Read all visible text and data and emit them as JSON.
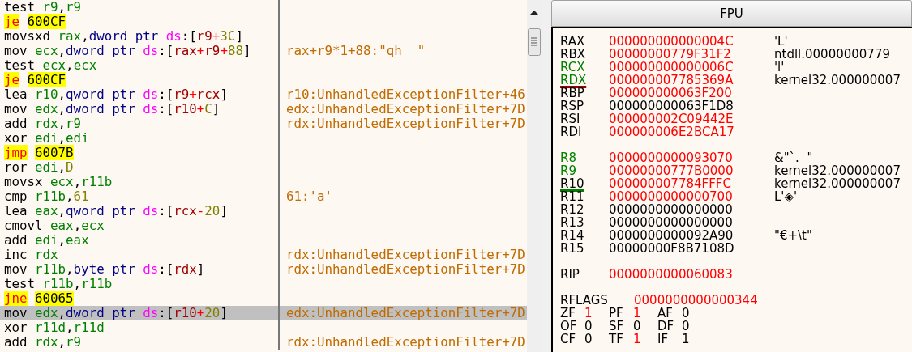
{
  "disassembly": [
    {
      "tokens": [
        {
          "text": "test ",
          "kind": "mnemonic"
        },
        {
          "text": "r9",
          "kind": "register"
        },
        {
          "text": ",",
          "kind": "punct"
        },
        {
          "text": "r9",
          "kind": "register"
        }
      ],
      "selected": false
    },
    {
      "tokens": [
        {
          "text": "je",
          "kind": "jump"
        },
        {
          "text": "600CF",
          "kind": "target"
        }
      ],
      "selected": false
    },
    {
      "tokens": [
        {
          "text": "movsxd ",
          "kind": "mnemonic"
        },
        {
          "text": "rax",
          "kind": "register"
        },
        {
          "text": ",",
          "kind": "punct"
        },
        {
          "text": "dword ptr ",
          "kind": "size"
        },
        {
          "text": "ds",
          "kind": "segment"
        },
        {
          "text": ":[",
          "kind": "punct"
        },
        {
          "text": "r9",
          "kind": "memreg"
        },
        {
          "text": "+",
          "kind": "operator"
        },
        {
          "text": "3C",
          "kind": "number"
        },
        {
          "text": "]",
          "kind": "punct"
        }
      ],
      "selected": false
    },
    {
      "tokens": [
        {
          "text": "mov ",
          "kind": "mnemonic"
        },
        {
          "text": "ecx",
          "kind": "register"
        },
        {
          "text": ",",
          "kind": "punct"
        },
        {
          "text": "dword ptr ",
          "kind": "size"
        },
        {
          "text": "ds",
          "kind": "segment"
        },
        {
          "text": ":[",
          "kind": "punct"
        },
        {
          "text": "rax",
          "kind": "memreg"
        },
        {
          "text": "+",
          "kind": "operator"
        },
        {
          "text": "r9",
          "kind": "memreg"
        },
        {
          "text": "+",
          "kind": "operator"
        },
        {
          "text": "88",
          "kind": "number"
        },
        {
          "text": "]",
          "kind": "punct"
        }
      ],
      "comment": "rax+r9*1+88:\"qh  \"",
      "selected": false
    },
    {
      "tokens": [
        {
          "text": "test ",
          "kind": "mnemonic"
        },
        {
          "text": "ecx",
          "kind": "register"
        },
        {
          "text": ",",
          "kind": "punct"
        },
        {
          "text": "ecx",
          "kind": "register"
        }
      ],
      "selected": false
    },
    {
      "tokens": [
        {
          "text": "je",
          "kind": "jump"
        },
        {
          "text": "600CF",
          "kind": "target"
        }
      ],
      "selected": false
    },
    {
      "tokens": [
        {
          "text": "lea ",
          "kind": "mnemonic"
        },
        {
          "text": "r10",
          "kind": "register"
        },
        {
          "text": ",",
          "kind": "punct"
        },
        {
          "text": "qword ptr ",
          "kind": "size"
        },
        {
          "text": "ds",
          "kind": "segment"
        },
        {
          "text": ":[",
          "kind": "punct"
        },
        {
          "text": "r9",
          "kind": "memreg"
        },
        {
          "text": "+",
          "kind": "operator"
        },
        {
          "text": "rcx",
          "kind": "memreg"
        },
        {
          "text": "]",
          "kind": "punct"
        }
      ],
      "comment": "r10:UnhandledExceptionFilter+46",
      "selected": false
    },
    {
      "tokens": [
        {
          "text": "mov ",
          "kind": "mnemonic"
        },
        {
          "text": "edx",
          "kind": "register"
        },
        {
          "text": ",",
          "kind": "punct"
        },
        {
          "text": "dword ptr ",
          "kind": "size"
        },
        {
          "text": "ds",
          "kind": "segment"
        },
        {
          "text": ":[",
          "kind": "punct"
        },
        {
          "text": "r10",
          "kind": "memreg"
        },
        {
          "text": "+",
          "kind": "operator"
        },
        {
          "text": "C",
          "kind": "number"
        },
        {
          "text": "]",
          "kind": "punct"
        }
      ],
      "comment": "edx:UnhandledExceptionFilter+7D",
      "selected": false
    },
    {
      "tokens": [
        {
          "text": "add ",
          "kind": "mnemonic"
        },
        {
          "text": "rdx",
          "kind": "register"
        },
        {
          "text": ",",
          "kind": "punct"
        },
        {
          "text": "r9",
          "kind": "register"
        }
      ],
      "comment": "rdx:UnhandledExceptionFilter+7D",
      "selected": false
    },
    {
      "tokens": [
        {
          "text": "xor ",
          "kind": "mnemonic"
        },
        {
          "text": "edi",
          "kind": "register"
        },
        {
          "text": ",",
          "kind": "punct"
        },
        {
          "text": "edi",
          "kind": "register"
        }
      ],
      "selected": false
    },
    {
      "tokens": [
        {
          "text": "jmp",
          "kind": "jump"
        },
        {
          "text": "6007B",
          "kind": "target"
        }
      ],
      "selected": false
    },
    {
      "tokens": [
        {
          "text": "ror ",
          "kind": "mnemonic"
        },
        {
          "text": "edi",
          "kind": "register"
        },
        {
          "text": ",",
          "kind": "punct"
        },
        {
          "text": "D",
          "kind": "number"
        }
      ],
      "selected": false
    },
    {
      "tokens": [
        {
          "text": "movsx ",
          "kind": "mnemonic"
        },
        {
          "text": "ecx",
          "kind": "register"
        },
        {
          "text": ",",
          "kind": "punct"
        },
        {
          "text": "r11b",
          "kind": "register"
        }
      ],
      "selected": false
    },
    {
      "tokens": [
        {
          "text": "cmp ",
          "kind": "mnemonic"
        },
        {
          "text": "r11b",
          "kind": "register"
        },
        {
          "text": ",",
          "kind": "punct"
        },
        {
          "text": "61",
          "kind": "number"
        }
      ],
      "comment": "61:'a'",
      "selected": false
    },
    {
      "tokens": [
        {
          "text": "lea ",
          "kind": "mnemonic"
        },
        {
          "text": "eax",
          "kind": "register"
        },
        {
          "text": ",",
          "kind": "punct"
        },
        {
          "text": "qword ptr ",
          "kind": "size"
        },
        {
          "text": "ds",
          "kind": "segment"
        },
        {
          "text": ":[",
          "kind": "punct"
        },
        {
          "text": "rcx",
          "kind": "memreg"
        },
        {
          "text": "-",
          "kind": "operator"
        },
        {
          "text": "20",
          "kind": "number"
        },
        {
          "text": "]",
          "kind": "punct"
        }
      ],
      "selected": false
    },
    {
      "tokens": [
        {
          "text": "cmovl ",
          "kind": "mnemonic"
        },
        {
          "text": "eax",
          "kind": "register"
        },
        {
          "text": ",",
          "kind": "punct"
        },
        {
          "text": "ecx",
          "kind": "register"
        }
      ],
      "selected": false
    },
    {
      "tokens": [
        {
          "text": "add ",
          "kind": "mnemonic"
        },
        {
          "text": "edi",
          "kind": "register"
        },
        {
          "text": ",",
          "kind": "punct"
        },
        {
          "text": "eax",
          "kind": "register"
        }
      ],
      "selected": false
    },
    {
      "tokens": [
        {
          "text": "inc ",
          "kind": "mnemonic"
        },
        {
          "text": "rdx",
          "kind": "register"
        }
      ],
      "comment": "rdx:UnhandledExceptionFilter+7D",
      "selected": false
    },
    {
      "tokens": [
        {
          "text": "mov ",
          "kind": "mnemonic"
        },
        {
          "text": "r11b",
          "kind": "register"
        },
        {
          "text": ",",
          "kind": "punct"
        },
        {
          "text": "byte ptr ",
          "kind": "size"
        },
        {
          "text": "ds",
          "kind": "segment"
        },
        {
          "text": ":[",
          "kind": "punct"
        },
        {
          "text": "rdx",
          "kind": "memreg"
        },
        {
          "text": "]",
          "kind": "punct"
        }
      ],
      "comment": "rdx:UnhandledExceptionFilter+7D",
      "selected": false
    },
    {
      "tokens": [
        {
          "text": "test ",
          "kind": "mnemonic"
        },
        {
          "text": "r11b",
          "kind": "register"
        },
        {
          "text": ",",
          "kind": "punct"
        },
        {
          "text": "r11b",
          "kind": "register"
        }
      ],
      "selected": false
    },
    {
      "tokens": [
        {
          "text": "jne",
          "kind": "jump"
        },
        {
          "text": "60065",
          "kind": "target"
        }
      ],
      "selected": false
    },
    {
      "tokens": [
        {
          "text": "mov ",
          "kind": "mnemonic"
        },
        {
          "text": "edx",
          "kind": "register"
        },
        {
          "text": ",",
          "kind": "punct"
        },
        {
          "text": "dword ptr ",
          "kind": "size"
        },
        {
          "text": "ds",
          "kind": "segment"
        },
        {
          "text": ":[",
          "kind": "punct"
        },
        {
          "text": "r10",
          "kind": "memreg"
        },
        {
          "text": "+",
          "kind": "operator"
        },
        {
          "text": "20",
          "kind": "number"
        },
        {
          "text": "]",
          "kind": "punct"
        }
      ],
      "comment": "edx:UnhandledExceptionFilter+7D",
      "selected": true
    },
    {
      "tokens": [
        {
          "text": "xor ",
          "kind": "mnemonic"
        },
        {
          "text": "r11d",
          "kind": "register"
        },
        {
          "text": ",",
          "kind": "punct"
        },
        {
          "text": "r11d",
          "kind": "register"
        }
      ],
      "selected": false
    },
    {
      "tokens": [
        {
          "text": "add ",
          "kind": "mnemonic"
        },
        {
          "text": "rdx",
          "kind": "register"
        },
        {
          "text": ",",
          "kind": "punct"
        },
        {
          "text": "r9",
          "kind": "register"
        }
      ],
      "comment": "rdx:UnhandledExceptionFilter+7D",
      "selected": false
    }
  ],
  "fpu_tab": {
    "label": "FPU"
  },
  "register_groups": [
    [
      {
        "name": "RAX",
        "value": "000000000000004C",
        "comment": "'L'",
        "modified": false,
        "changed": true
      },
      {
        "name": "RBX",
        "value": "00000000779F31F2",
        "comment": "ntdll.00000000779",
        "modified": false,
        "changed": true
      },
      {
        "name": "RCX",
        "value": "000000000000006C",
        "comment": "'l'",
        "modified": true,
        "changed": true
      },
      {
        "name": "RDX",
        "value": "000000007785369A",
        "comment": "kernel32.000000007",
        "modified": true,
        "changed": true,
        "color": "#a00000"
      },
      {
        "name": "RBP",
        "value": "000000000063F200",
        "modified": false,
        "changed": true
      },
      {
        "name": "RSP",
        "value": "000000000063F1D8",
        "modified": false,
        "changed": false
      },
      {
        "name": "RSI",
        "value": "000000002C09442E",
        "modified": false,
        "changed": true
      },
      {
        "name": "RDI",
        "value": "000000006E2BCA17",
        "modified": false,
        "changed": true
      }
    ],
    [
      {
        "name": "R8",
        "value": "0000000000093070",
        "comment": "&\"`.  \"",
        "modified": true,
        "changed": true
      },
      {
        "name": "R9",
        "value": "00000000777B0000",
        "comment": "kernel32.000000007",
        "modified": true,
        "changed": true
      },
      {
        "name": "R10",
        "value": "000000007784FFFC",
        "comment": "kernel32.000000007",
        "modified": false,
        "changed": true,
        "color": "#008000"
      },
      {
        "name": "R11",
        "value": "0000000000000700",
        "comment": "L'◈'",
        "modified": false,
        "changed": true
      },
      {
        "name": "R12",
        "value": "0000000000000000",
        "modified": false,
        "changed": false
      },
      {
        "name": "R13",
        "value": "0000000000000000",
        "modified": false,
        "changed": false
      },
      {
        "name": "R14",
        "value": "0000000000092A90",
        "comment": "\"€+\\t\"",
        "modified": false,
        "changed": false
      },
      {
        "name": "R15",
        "value": "00000000F8B7108D",
        "modified": false,
        "changed": false
      }
    ],
    [
      {
        "name": "RIP",
        "value": "0000000000060083",
        "modified": false,
        "changed": true
      }
    ]
  ],
  "rflags": {
    "name": "RFLAGS",
    "value": "0000000000000344",
    "changed": true
  },
  "flags": [
    [
      {
        "name": "ZF",
        "value": "1",
        "changed": true
      },
      {
        "name": "PF",
        "value": "1",
        "changed": true
      },
      {
        "name": "AF",
        "value": "0",
        "changed": false
      }
    ],
    [
      {
        "name": "OF",
        "value": "0",
        "changed": false
      },
      {
        "name": "SF",
        "value": "0",
        "changed": false
      },
      {
        "name": "DF",
        "value": "0",
        "changed": false
      }
    ],
    [
      {
        "name": "CF",
        "value": "0",
        "changed": false
      },
      {
        "name": "TF",
        "value": "1",
        "changed": true
      },
      {
        "name": "IF",
        "value": "1",
        "changed": false
      }
    ]
  ]
}
